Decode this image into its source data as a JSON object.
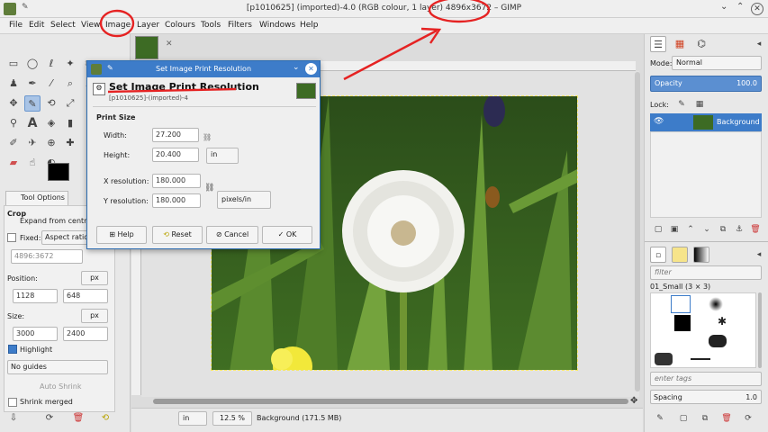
{
  "window": {
    "title_pre": "[p1010625] (imported)-4.0 (RGB colour, 1 layer) ",
    "title_size": "4896x3672",
    "title_post": " – GIMP"
  },
  "menu": [
    "File",
    "Edit",
    "Select",
    "View",
    "Image",
    "Layer",
    "Colours",
    "Tools",
    "Filters",
    "Windows",
    "Help"
  ],
  "tool_options": {
    "tab_label": "Tool Options",
    "tool_name": "Crop",
    "expand_label": "Expand from centre",
    "fixed_label": "Fixed:",
    "fixed_value": "Aspect ratio",
    "ratio_value": "4896:3672",
    "position_label": "Position:",
    "position_unit": "px",
    "pos_x": "1128",
    "pos_y": "648",
    "size_label": "Size:",
    "size_unit": "px",
    "size_w": "3000",
    "size_h": "2400",
    "highlight_label": "Highlight",
    "guides_value": "No guides",
    "autoshrink_label": "Auto Shrink",
    "shrink_merged_label": "Shrink merged"
  },
  "dialog": {
    "title": "Set Image Print Resolution",
    "heading": "Set Image Print Resolution",
    "subheading": "[p1010625]-(imported)-4",
    "section": "Print Size",
    "width_label": "Width:",
    "width_value": "27.200",
    "height_label": "Height:",
    "height_value": "20.400",
    "size_unit": "in",
    "xres_label": "X resolution:",
    "xres_value": "180.000",
    "yres_label": "Y resolution:",
    "yres_value": "180.000",
    "res_unit": "pixels/in",
    "help": "Help",
    "reset": "Reset",
    "cancel": "Cancel",
    "ok": "OK"
  },
  "statusbar": {
    "unit": "in",
    "zoom": "12.5 %",
    "info": "Background (171.5 MB)"
  },
  "layers": {
    "mode_label": "Mode:",
    "mode_value": "Normal",
    "opacity_label": "Opacity",
    "opacity_value": "100.0",
    "lock_label": "Lock:",
    "layer_name": "Background"
  },
  "brushes": {
    "filter_placeholder": "filter",
    "brush_name": "01_Small (3 × 3)",
    "tags_placeholder": "enter tags",
    "spacing_label": "Spacing",
    "spacing_value": "1.0"
  },
  "colors": {
    "accent": "#3d7cc9",
    "annotation": "#e52222",
    "foreground": "#000000",
    "background": "#ffffff"
  }
}
